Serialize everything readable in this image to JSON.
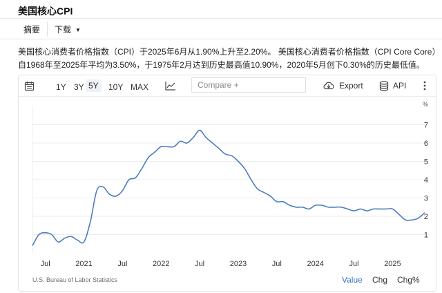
{
  "page_title": "美国核心CPI",
  "tabs": {
    "summary": "摘要",
    "download": "下载"
  },
  "summary_text": "美国核心消费者价格指数（CPI）于2025年6月从1.90%上升至2.20%。 美国核心消费者价格指数（CPI Core Core）自1968年至2025年平均为3.50%，于1975年2月达到历史最高值10.90%，2020年5月创下0.30%的历史最低值。",
  "toolbar": {
    "ranges": [
      "1Y",
      "3Y",
      "5Y",
      "10Y",
      "MAX"
    ],
    "active_range": "5Y",
    "compare_placeholder": "Compare +",
    "export_label": "Export",
    "api_label": "API",
    "icons": [
      "calendar-icon",
      "line-chart-icon",
      "cloud-download-icon",
      "database-icon",
      "more-vertical-icon"
    ]
  },
  "footer": {
    "source": "U.S. Bureau of Labor Statistics",
    "modes": [
      "Value",
      "Chg",
      "Chg%"
    ],
    "active_mode": "Value"
  },
  "chart_data": {
    "type": "line",
    "unit_label": "%",
    "line_color": "#4a7cbf",
    "grid": "horizontal",
    "y_axis_side": "right",
    "ylim": [
      0,
      8
    ],
    "y_ticks": [
      1,
      2,
      3,
      4,
      5,
      6,
      7
    ],
    "x_range": [
      "2020-05",
      "2025-06"
    ],
    "x_ticks": [
      {
        "label": "Jul",
        "date": "2020-07"
      },
      {
        "label": "2021",
        "date": "2021-01"
      },
      {
        "label": "Jul",
        "date": "2021-07"
      },
      {
        "label": "2022",
        "date": "2022-01"
      },
      {
        "label": "Jul",
        "date": "2022-07"
      },
      {
        "label": "2023",
        "date": "2023-01"
      },
      {
        "label": "Jul",
        "date": "2023-07"
      },
      {
        "label": "2024",
        "date": "2024-01"
      },
      {
        "label": "Jul",
        "date": "2024-07"
      },
      {
        "label": "2025",
        "date": "2025-01"
      }
    ],
    "series": [
      {
        "x": [
          "2020-05",
          "2020-06",
          "2020-07",
          "2020-08",
          "2020-09",
          "2020-10",
          "2020-11",
          "2020-12",
          "2021-01",
          "2021-02",
          "2021-03",
          "2021-04",
          "2021-05",
          "2021-06",
          "2021-07",
          "2021-08",
          "2021-09",
          "2021-10",
          "2021-11",
          "2021-12",
          "2022-01",
          "2022-02",
          "2022-03",
          "2022-04",
          "2022-05",
          "2022-06",
          "2022-07",
          "2022-08",
          "2022-09",
          "2022-10",
          "2022-11",
          "2022-12",
          "2023-01",
          "2023-02",
          "2023-03",
          "2023-04",
          "2023-05",
          "2023-06",
          "2023-07",
          "2023-08",
          "2023-09",
          "2023-10",
          "2023-11",
          "2023-12",
          "2024-01",
          "2024-02",
          "2024-03",
          "2024-04",
          "2024-05",
          "2024-06",
          "2024-07",
          "2024-08",
          "2024-09",
          "2024-10",
          "2024-11",
          "2024-12",
          "2025-01",
          "2025-02",
          "2025-03",
          "2025-04",
          "2025-05",
          "2025-06"
        ],
        "values": [
          0.4,
          1.0,
          1.1,
          1.0,
          0.6,
          0.8,
          0.9,
          0.7,
          0.6,
          1.7,
          3.4,
          3.6,
          3.2,
          3.1,
          3.4,
          4.0,
          4.1,
          4.6,
          5.2,
          5.5,
          5.8,
          5.8,
          5.8,
          6.1,
          6.0,
          6.3,
          6.7,
          6.3,
          6.0,
          5.7,
          5.4,
          5.3,
          5.0,
          4.6,
          4.0,
          3.5,
          3.3,
          3.1,
          2.8,
          2.8,
          2.6,
          2.5,
          2.5,
          2.4,
          2.6,
          2.6,
          2.5,
          2.5,
          2.5,
          2.4,
          2.3,
          2.4,
          2.3,
          2.4,
          2.4,
          2.4,
          2.4,
          2.1,
          1.8,
          1.8,
          1.9,
          2.2
        ]
      }
    ]
  }
}
